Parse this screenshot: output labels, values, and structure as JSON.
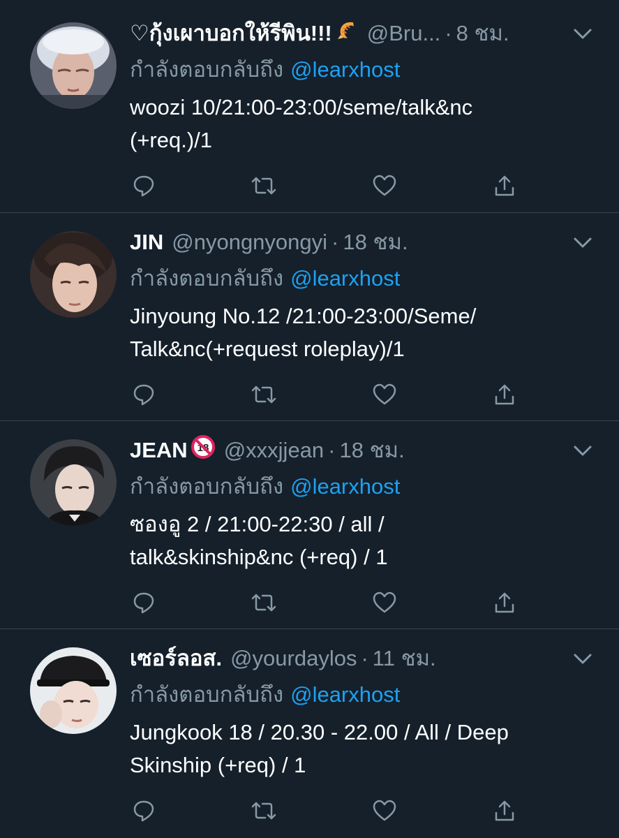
{
  "reply_prefix": "กำลังตอบกลับถึง",
  "tweets": [
    {
      "display_name": "♡กุ้งเผาบอกให้รีพิน!!!",
      "emoji": "shrimp-emoji",
      "handle": "@Bru...",
      "dot": "·",
      "time": "8 ชม.",
      "mention": "@learxhost",
      "text_lines": [
        "woozi 10/21:00-23:00/seme/talk&nc",
        "(+req.)/1"
      ]
    },
    {
      "display_name": "JIN",
      "handle": "@nyongnyongyi",
      "dot": "·",
      "time": "18 ชม.",
      "mention": "@learxhost",
      "text_lines": [
        "Jinyoung No.12 /21:00-23:00/Seme/",
        "Talk&nc(+request roleplay)/1"
      ]
    },
    {
      "display_name": "JEAN",
      "emoji": "no-under-18-emoji",
      "handle": "@xxxjjean",
      "dot": "·",
      "time": "18 ชม.",
      "mention": "@learxhost",
      "text_lines": [
        "ซองอู 2 / 21:00-22:30 / all /",
        "talk&skinship&nc (+req) / 1"
      ]
    },
    {
      "display_name": "เซอร์ลอส.",
      "handle": "@yourdaylos",
      "dot": "·",
      "time": "11 ชม.",
      "mention": "@learxhost",
      "text_lines": [
        "Jungkook 18 / 20.30 - 22.00 / All / Deep",
        "Skinship (+req) / 1"
      ]
    }
  ],
  "colors": {
    "background": "#15202b",
    "divider": "#38444d",
    "secondary_text": "#8899a6",
    "link": "#1da1f2",
    "icon": "#8899a6"
  }
}
